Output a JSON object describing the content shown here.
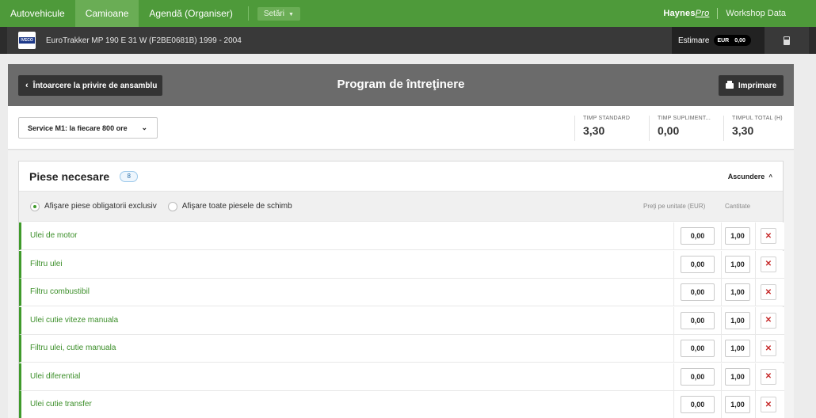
{
  "topnav": {
    "tabs": [
      {
        "label": "Autovehicule"
      },
      {
        "label": "Camioane"
      },
      {
        "label": "Agendă (Organiser)"
      }
    ],
    "settings_label": "Setări",
    "brand_main": "Haynes",
    "brand_pro": "Pro",
    "workshop_data": "Workshop Data"
  },
  "vehicle": {
    "logo_text": "IVECO",
    "name": "EuroTrakker MP 190 E 31 W (F2BE0681B) 1999 - 2004",
    "estimate_label": "Estimare",
    "currency": "EUR",
    "estimate_value": "0,00"
  },
  "header": {
    "back_label": "Întoarcere la privire de ansamblu",
    "title": "Program de întreţinere",
    "print_label": "Imprimare"
  },
  "service": {
    "selected": "Service M1: la fiecare 800 ore",
    "times": [
      {
        "label": "TIMP STANDARD",
        "value": "3,30"
      },
      {
        "label": "TIMP SUPLIMENT...",
        "value": "0,00"
      },
      {
        "label": "TIMPUL TOTAL (H)",
        "value": "3,30"
      }
    ]
  },
  "parts": {
    "title": "Piese necesare",
    "count": "8",
    "hide_label": "Ascundere",
    "filter_mandatory": "Afişare piese obligatorii exclusiv",
    "filter_all": "Afişare toate piesele de schimb",
    "col_price": "Preţi pe unitate (EUR)",
    "col_qty": "Cantitate",
    "rows": [
      {
        "name": "Ulei de motor",
        "price": "0,00",
        "qty": "1,00"
      },
      {
        "name": "Filtru ulei",
        "price": "0,00",
        "qty": "1,00"
      },
      {
        "name": "Filtru combustibil",
        "price": "0,00",
        "qty": "1,00"
      },
      {
        "name": "Ulei cutie viteze manuala",
        "price": "0,00",
        "qty": "1,00"
      },
      {
        "name": "Filtru ulei, cutie manuala",
        "price": "0,00",
        "qty": "1,00"
      },
      {
        "name": "Ulei diferential",
        "price": "0,00",
        "qty": "1,00"
      },
      {
        "name": "Ulei cutie transfer",
        "price": "0,00",
        "qty": "1,00"
      }
    ]
  },
  "colors": {
    "nav_green": "#4e9a3a",
    "active_tab": "#6aad55",
    "part_green": "#3c8f2a",
    "delete_red": "#c62828",
    "header_gray": "#6b6b6b"
  },
  "icons": {
    "back": "chevron-left-icon",
    "print": "printer-icon",
    "calculator": "calculator-icon",
    "delete": "close-icon"
  }
}
